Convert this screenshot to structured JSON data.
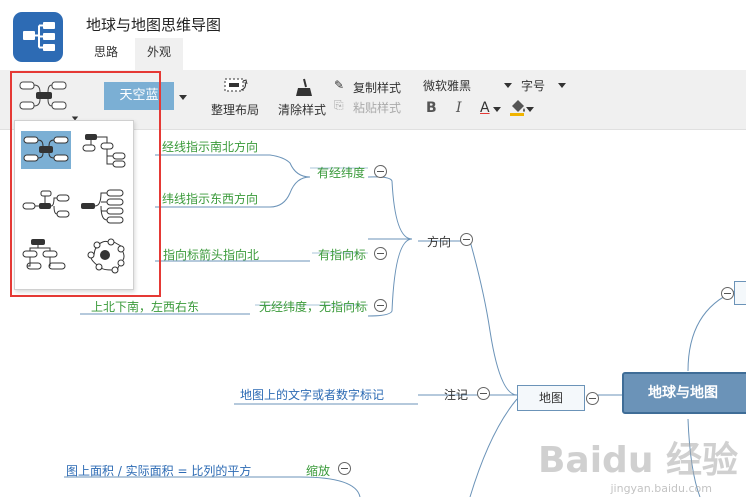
{
  "app": {
    "title": "地球与地图思维导图",
    "logo_icon": "mindmap-logo-icon",
    "tabs": [
      {
        "label": "思路",
        "active": false
      },
      {
        "label": "外观",
        "active": true
      }
    ]
  },
  "toolbar": {
    "theme_label": "天空蓝",
    "arrange_label": "整理布局",
    "clear_style_label": "清除样式",
    "copy_style_label": "复制样式",
    "paste_style_label": "粘贴样式",
    "font_value": "微软雅黑",
    "size_label": "字号",
    "bold_label": "B",
    "italic_label": "I",
    "font_color_label": "A"
  },
  "layout_dropdown": {
    "options": [
      {
        "name": "mindmap-layout",
        "selected": true
      },
      {
        "name": "org-tree-layout",
        "selected": false
      },
      {
        "name": "horizontal-tree-layout",
        "selected": false
      },
      {
        "name": "right-logic-layout",
        "selected": false
      },
      {
        "name": "org-chart-layout",
        "selected": false
      },
      {
        "name": "fishbone-layout",
        "selected": false
      }
    ]
  },
  "mindmap": {
    "root": "地球与地图",
    "map_node": "地图",
    "direction": "方向",
    "latlong": "有经纬度",
    "longitude_text": "经线指示南北方向",
    "latitude_text": "纬线指示东西方向",
    "has_arrow": "有指向标",
    "arrow_text": "指向标箭头指向北",
    "no_latlong": "无经纬度，无指向标",
    "no_latlong_text": "上北下南，左西右东",
    "note": "注记",
    "note_text": "地图上的文字或者数字标记",
    "scale": "缩放",
    "scale_text": "图上面积 / 实际面积 = 比列的平方"
  },
  "watermark": {
    "text": "Baidu 经验",
    "sub": "jingyan.baidu.com"
  },
  "colors": {
    "accent": "#7bafd4",
    "link": "#3a9a3a",
    "blue_text": "#2d6bb4",
    "root": "#6b93b8"
  }
}
